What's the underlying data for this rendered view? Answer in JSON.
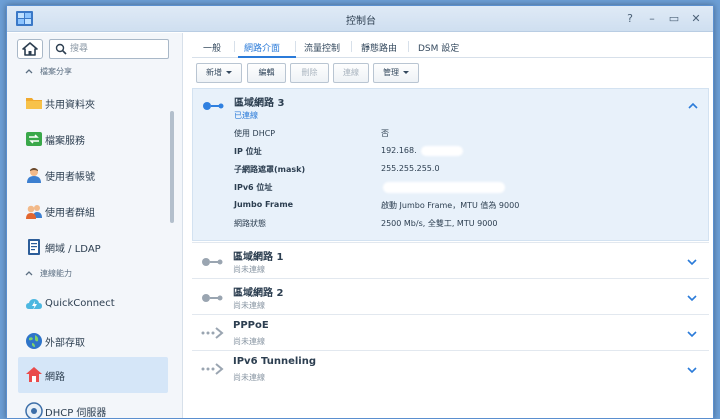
{
  "window": {
    "title": "控制台",
    "controls": [
      "?",
      "–",
      "▭",
      "✕"
    ]
  },
  "sidebar": {
    "search_placeholder": "搜尋",
    "sections": [
      {
        "label": "檔案分享"
      },
      {
        "label": "連線能力"
      }
    ],
    "items": [
      {
        "label": "共用資料夾",
        "icon": "shared-folder-icon"
      },
      {
        "label": "檔案服務",
        "icon": "file-services-icon"
      },
      {
        "label": "使用者帳號",
        "icon": "user-icon"
      },
      {
        "label": "使用者群組",
        "icon": "group-icon"
      },
      {
        "label": "網域 / LDAP",
        "icon": "domain-ldap-icon"
      },
      {
        "label": "QuickConnect",
        "icon": "quickconnect-icon"
      },
      {
        "label": "外部存取",
        "icon": "external-access-icon"
      },
      {
        "label": "網路",
        "icon": "network-icon",
        "active": true
      },
      {
        "label": "DHCP 伺服器",
        "icon": "dhcp-server-icon"
      }
    ]
  },
  "tabs": [
    {
      "label": "一般"
    },
    {
      "label": "網路介面",
      "active": true
    },
    {
      "label": "流量控制"
    },
    {
      "label": "靜態路由"
    },
    {
      "label": "DSM 設定"
    }
  ],
  "toolbar": {
    "create": "新增",
    "edit": "編輯",
    "delete": "刪除",
    "connect": "連線",
    "manage": "管理"
  },
  "interfaces": [
    {
      "name": "區域網路 3",
      "status": "已連線",
      "expanded": true,
      "details": [
        {
          "key": "使用 DHCP",
          "value": "否"
        },
        {
          "key": "IP 位址",
          "value": "192.168."
        },
        {
          "key": "子網路遮罩(mask)",
          "value": "255.255.255.0"
        },
        {
          "key": "IPv6 位址",
          "value": ""
        },
        {
          "key": "Jumbo Frame",
          "value": "啟動 Jumbo Frame，MTU 值為 9000"
        },
        {
          "key": "網路狀態",
          "value": "2500 Mb/s, 全雙工, MTU 9000"
        }
      ]
    },
    {
      "name": "區域網路 1",
      "status": "尚未連線"
    },
    {
      "name": "區域網路 2",
      "status": "尚未連線"
    },
    {
      "name": "PPPoE",
      "status": "尚未連線"
    },
    {
      "name": "IPv6 Tunneling",
      "status": "尚未連線"
    }
  ],
  "colors": {
    "accent": "#2b7bd9",
    "active_item_bg": "#d5e6f8",
    "expanded_bg": "#e8f1fa",
    "connected_icon": "#2f80e0",
    "disconnected_icon": "#9aa5b1"
  }
}
